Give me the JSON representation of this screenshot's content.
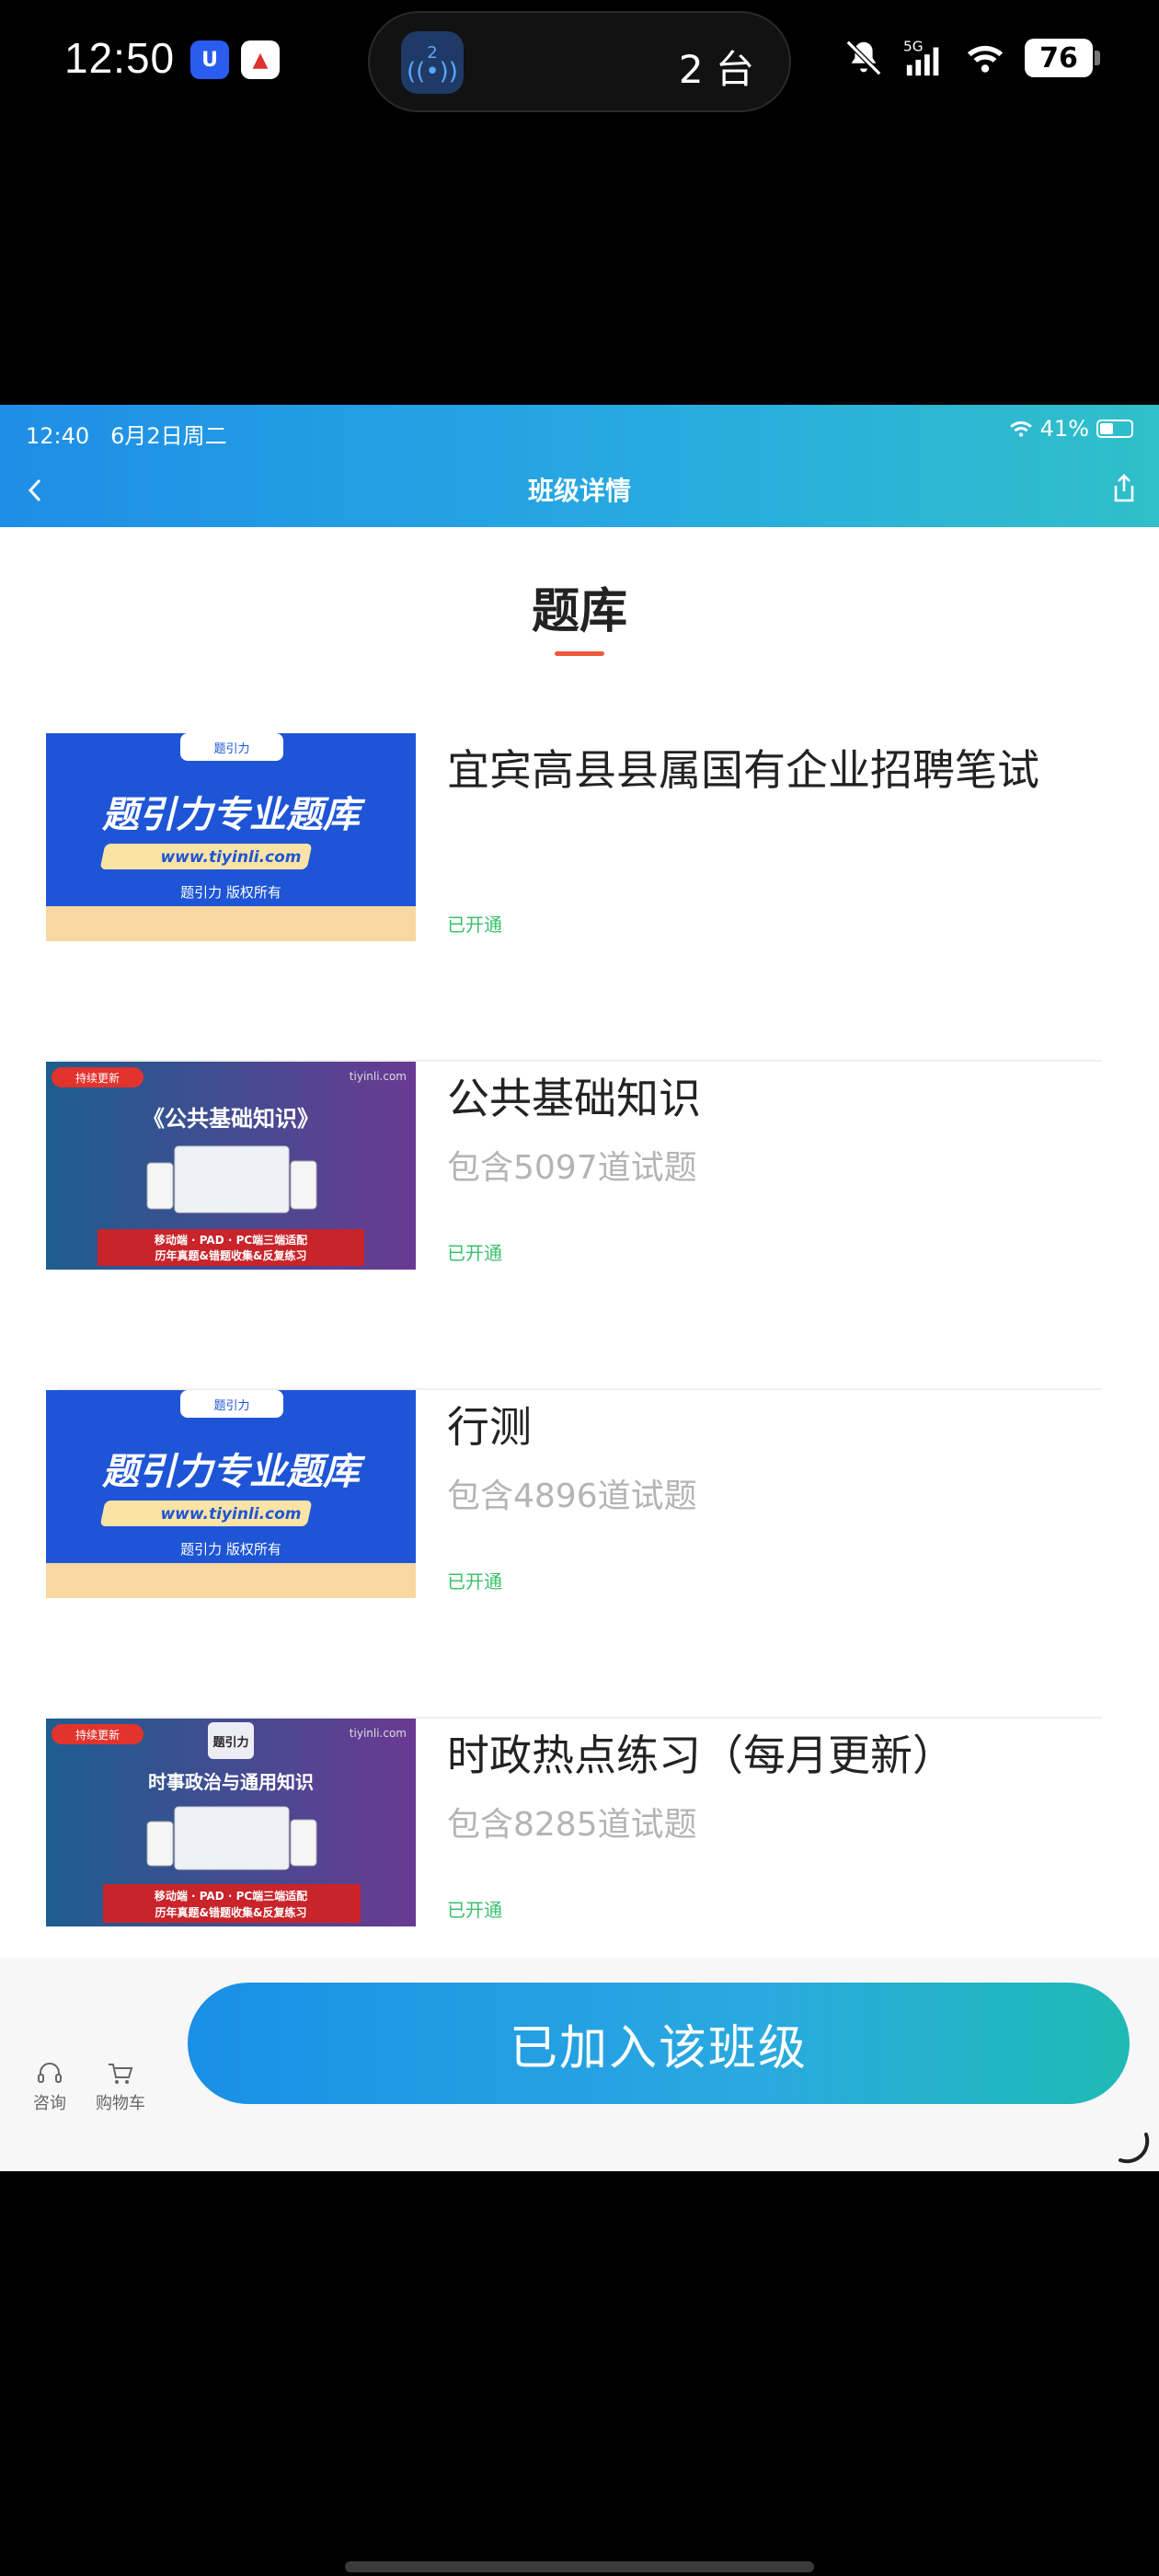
{
  "phone_status": {
    "time": "12:50",
    "island_badge": "2",
    "island_text": "2 台",
    "network": "5G",
    "battery": "76"
  },
  "inner_status": {
    "time": "12:40",
    "date": "6月2日周二",
    "battery": "41%"
  },
  "header": {
    "title": "班级详情"
  },
  "section": {
    "title": "题库"
  },
  "thumbs": {
    "brand_title": "题引力专业题库",
    "brand_url": "www.tiyinli.com",
    "brand_copyright": "题引力 版权所有",
    "brand_top": "题引力",
    "badge_updating": "持续更新",
    "site": "tiyinli.com",
    "logo_text": "题引力",
    "gongji_title": "《公共基础知识》",
    "shizheng_title": "时事政治与通用知识",
    "bar_line1": "移动端 · PAD · PC端三端适配",
    "bar_line2": "历年真题&错题收集&反复练习"
  },
  "items": [
    {
      "title": "宜宾高县县属国有企业招聘笔试",
      "subtitle": "",
      "status": "已开通",
      "thumb": "brand"
    },
    {
      "title": "公共基础知识",
      "subtitle": "包含5097道试题",
      "status": "已开通",
      "thumb": "gongji"
    },
    {
      "title": "行测",
      "subtitle": "包含4896道试题",
      "status": "已开通",
      "thumb": "brand"
    },
    {
      "title": "时政热点练习（每月更新）",
      "subtitle": "包含8285道试题",
      "status": "已开通",
      "thumb": "shizheng"
    }
  ],
  "bottom": {
    "consult": "咨询",
    "cart": "购物车",
    "join_button": "已加入该班级"
  },
  "colors": {
    "accent": "#1f8ee6",
    "status_green": "#3cc06c",
    "underline": "#ee5a3d"
  }
}
